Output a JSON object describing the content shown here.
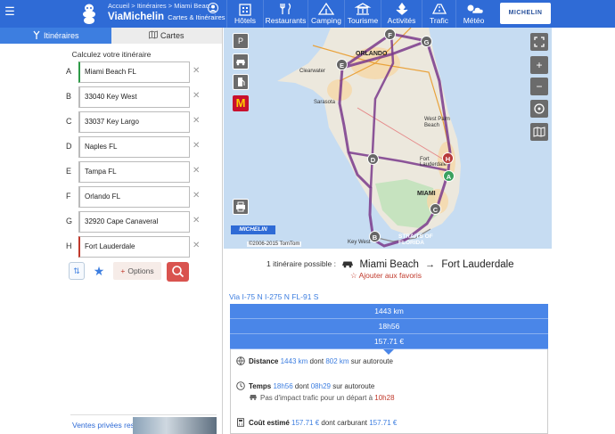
{
  "header": {
    "breadcrumb": "Accueil > Itinéraires > Miami Beac...",
    "brand_name": "ViaMichelin",
    "brand_sub": "Cartes & Itinéraires",
    "nav": [
      {
        "label": "Hôtels",
        "icon": "hotel-icon"
      },
      {
        "label": "Restaurants",
        "icon": "restaurant-icon"
      },
      {
        "label": "Camping",
        "icon": "camping-icon"
      },
      {
        "label": "Tourisme",
        "icon": "tourism-icon"
      },
      {
        "label": "Activités",
        "icon": "activities-icon"
      },
      {
        "label": "Trafic",
        "icon": "traffic-icon"
      },
      {
        "label": "Météo",
        "icon": "weather-icon"
      }
    ],
    "logo_text": "MICHELIN"
  },
  "sidebar": {
    "tabs": [
      {
        "label": "Itinéraires",
        "icon": "route-icon",
        "active": true
      },
      {
        "label": "Cartes",
        "icon": "map-icon",
        "active": false
      }
    ],
    "title": "Calculez votre itinéraire",
    "stops": [
      {
        "letter": "A",
        "value": "Miami Beach FL"
      },
      {
        "letter": "B",
        "value": "33040 Key West"
      },
      {
        "letter": "C",
        "value": "33037 Key Largo"
      },
      {
        "letter": "D",
        "value": "Naples FL"
      },
      {
        "letter": "E",
        "value": "Tampa FL"
      },
      {
        "letter": "F",
        "value": "Orlando FL"
      },
      {
        "letter": "G",
        "value": "32920 Cape Canaveral"
      },
      {
        "letter": "H",
        "value": "Fort Lauderdale"
      }
    ],
    "remove_glyph": "✕",
    "options_label": "Options",
    "promo_text": "Ventes privées restaurants et"
  },
  "map": {
    "labels": {
      "orlando": "ORLANDO",
      "clearwater": "Clearwater",
      "sarasota": "Sarasota",
      "west_palm": "West Palm Beach",
      "ft_lauderdale": "Fort Lauderdale",
      "miami": "MIAMI",
      "key_west": "Key West",
      "straits": "STRAITS OF FLORIDA"
    },
    "watermark": "MICHELIN",
    "attribution": "©2006-2015 TomTom",
    "markers": [
      "F",
      "G",
      "E",
      "D",
      "H",
      "A",
      "C",
      "B"
    ],
    "left_controls": [
      "P",
      "car",
      "fuel"
    ],
    "mcdo": "M",
    "print_icon": "print-icon"
  },
  "results": {
    "count_text": "1 itinéraire possible :",
    "from": "Miami Beach",
    "to": "Fort Lauderdale",
    "favorites": "Ajouter aux favoris",
    "via": "Via I-75 N I-275 N FL-91 S",
    "distance_total": "1443 km",
    "duration_total": "18h56",
    "cost_total": "157.71 €",
    "distance": {
      "label": "Distance",
      "value": "1443 km",
      "mid": "dont",
      "highway": "802 km",
      "suffix": "sur autoroute"
    },
    "time": {
      "label": "Temps",
      "value": "18h56",
      "mid": "dont",
      "highway": "08h29",
      "suffix": "sur autoroute"
    },
    "traffic": {
      "text": "Pas d'impact trafic pour un départ à",
      "time": "10h28"
    },
    "cost": {
      "label": "Coût estimé",
      "value": "157.71 €",
      "mid": "dont carburant",
      "fuel": "157.71 €"
    }
  }
}
